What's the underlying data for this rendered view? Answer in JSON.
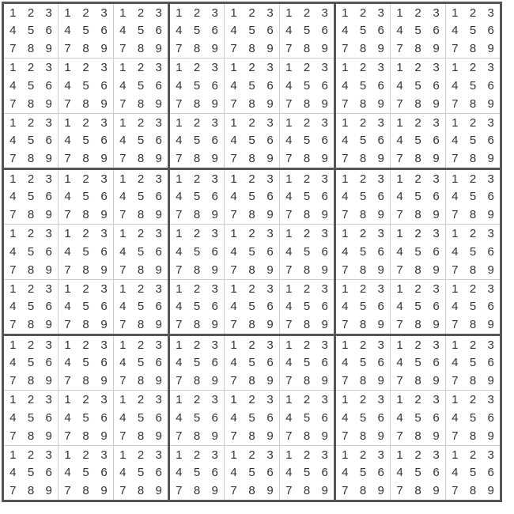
{
  "grid_size": 9,
  "box_size": 3,
  "candidate_labels": [
    "1",
    "2",
    "3",
    "4",
    "5",
    "6",
    "7",
    "8",
    "9"
  ],
  "cells": null,
  "note": "Every cell shows all nine candidates; no givens."
}
